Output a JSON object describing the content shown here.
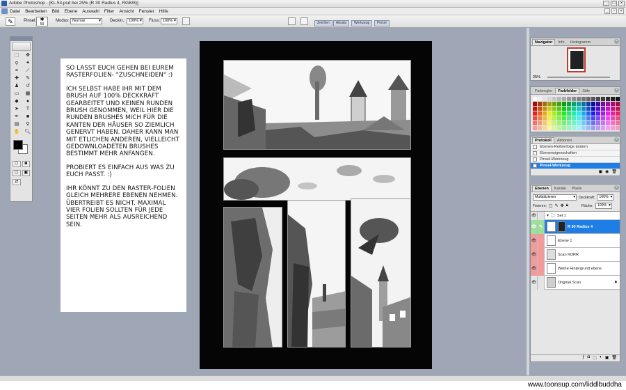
{
  "window": {
    "title": "Adobe Photoshop - [KL 53.psd bei 25% (R 30 Radius 4, RGB/8)]"
  },
  "menu": [
    "Datei",
    "Bearbeiten",
    "Bild",
    "Ebene",
    "Auswahl",
    "Filter",
    "Ansicht",
    "Fenster",
    "Hilfe"
  ],
  "options": {
    "pinsel_label": "Pinsel:",
    "brush_size": "50",
    "modus_label": "Modus:",
    "modus_value": "Normal",
    "deckkr_label": "Deckkr.:",
    "deckkr_value": "100%",
    "fluss_label": "Fluss:",
    "fluss_value": "100%",
    "well_tabs": [
      "Zeichen",
      "Absatz",
      "Werkzeug",
      "Pinsel"
    ]
  },
  "note": {
    "paragraphs": [
      "So lasst euch gehen bei eurem Rasterfolien- \"zuschneiden\" :)",
      "Ich selbst habe ihr mit dem Brush auf 100% Deckkraft gearbeitet und keinen runden Brush genommen, weil hier die runden Brushes mich für die Kanten der Häuser so ziemlich genervt haben. Daher kann man mit etlichen anderen, vielleicht gedownloadeten Brushes bestimmt mehr anfangen.",
      "Probiert es einfach aus was zu euch passt. :)",
      "Ihr könnt zu den Raster-folien gleich mehrere Ebenen nehmen. Übertreibt es nicht. Maximal vier Folien sollten für jede Seiten mehr als ausreichend sein."
    ]
  },
  "navigator": {
    "tabs": [
      "Navigator",
      "Info",
      "Histogramm"
    ],
    "zoom": "25%"
  },
  "swatches_panel": {
    "tabs": [
      "Farbregler",
      "Farbfelder",
      "Stile"
    ]
  },
  "history": {
    "tabs": [
      "Protokoll",
      "Aktionen"
    ],
    "items": [
      "Ebenen-Reihenfolge ändern",
      "Ebeneneigenschaften",
      "Pinsel-Werkzeug",
      "Pinsel-Werkzeug"
    ]
  },
  "layers": {
    "tabs": [
      "Ebenen",
      "Kanäle",
      "Pfade"
    ],
    "blend": "Multiplizieren",
    "opacity_label": "Deckkraft:",
    "opacity_value": "100%",
    "fix_label": "Fixieren:",
    "fill_label": "Fläche:",
    "fill_value": "100%",
    "set_name": "Set 1",
    "rows": [
      "R 30 Radius 4",
      "Ebene 1",
      "Scan KORR",
      "Weiße Hintergrund ebene",
      "Original Scan"
    ]
  },
  "watermark": "www.toonsup.com/liddlbuddha",
  "colors": {
    "workspace": "#9fa6b5",
    "selection": "#1f7ee6",
    "layer_pink": "#f29b9b",
    "canvas_border": "#050505"
  }
}
